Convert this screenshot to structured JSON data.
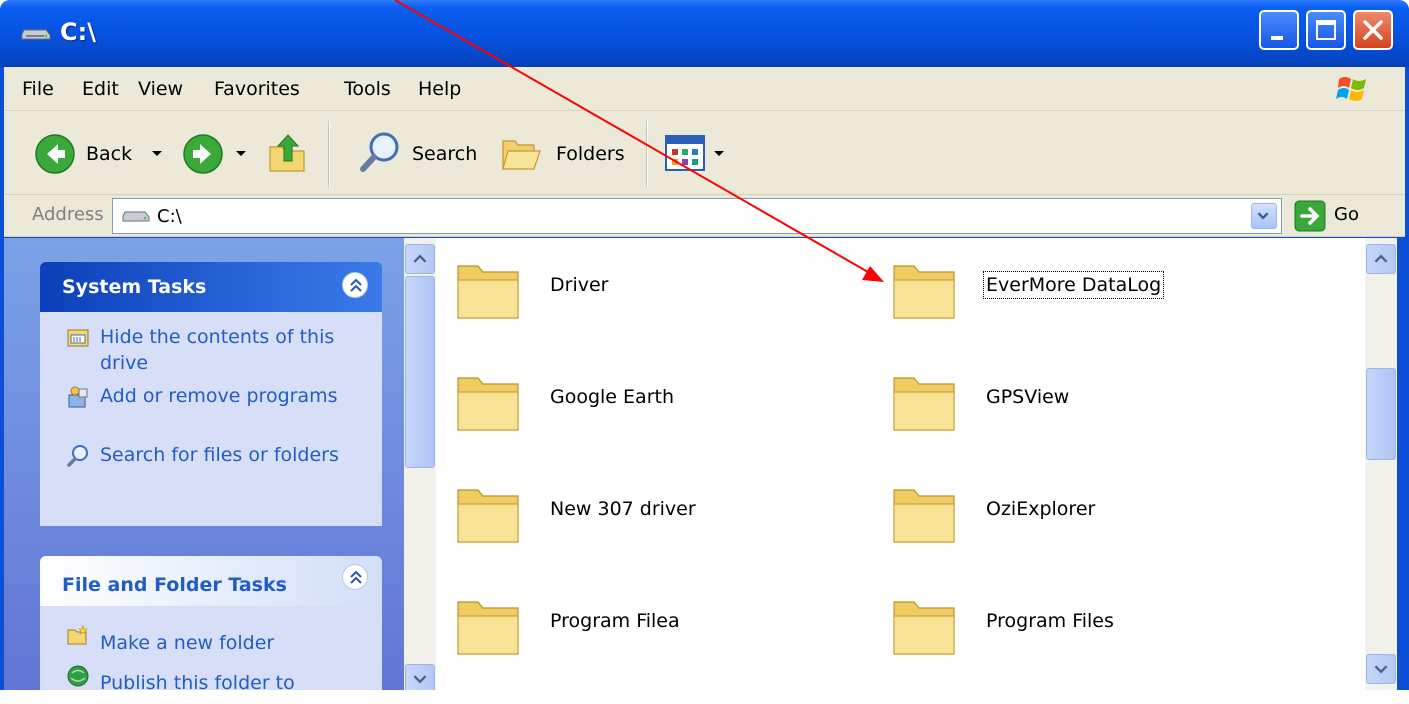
{
  "window": {
    "title": "C:\\",
    "icon": "drive-icon"
  },
  "menu": [
    "File",
    "Edit",
    "View",
    "Favorites",
    "Tools",
    "Help"
  ],
  "toolbar": {
    "back_label": "Back",
    "search_label": "Search",
    "folders_label": "Folders"
  },
  "address": {
    "label": "Address",
    "value": "C:\\",
    "go_label": "Go"
  },
  "system_tasks": {
    "title": "System Tasks",
    "items": [
      {
        "label": "Hide the contents of this drive",
        "icon": "hide-contents-icon"
      },
      {
        "label": "Add or remove programs",
        "icon": "add-remove-programs-icon"
      },
      {
        "label": "Search for files or folders",
        "icon": "search-icon"
      }
    ]
  },
  "file_folder_tasks": {
    "title": "File and Folder Tasks",
    "items": [
      {
        "label": "Make a new folder",
        "icon": "new-folder-icon"
      },
      {
        "label": "Publish this folder to",
        "icon": "publish-web-icon"
      }
    ]
  },
  "folders": [
    {
      "name": "Driver"
    },
    {
      "name": "EverMore DataLog",
      "focused": true
    },
    {
      "name": "Google Earth"
    },
    {
      "name": "GPSView"
    },
    {
      "name": "New 307 driver"
    },
    {
      "name": "OziExplorer"
    },
    {
      "name": "Program Filea"
    },
    {
      "name": "Program Files"
    }
  ],
  "colors": {
    "title_bar": "#0752e0",
    "task_link": "#215dc6",
    "annotation_arrow": "#ff0000"
  }
}
